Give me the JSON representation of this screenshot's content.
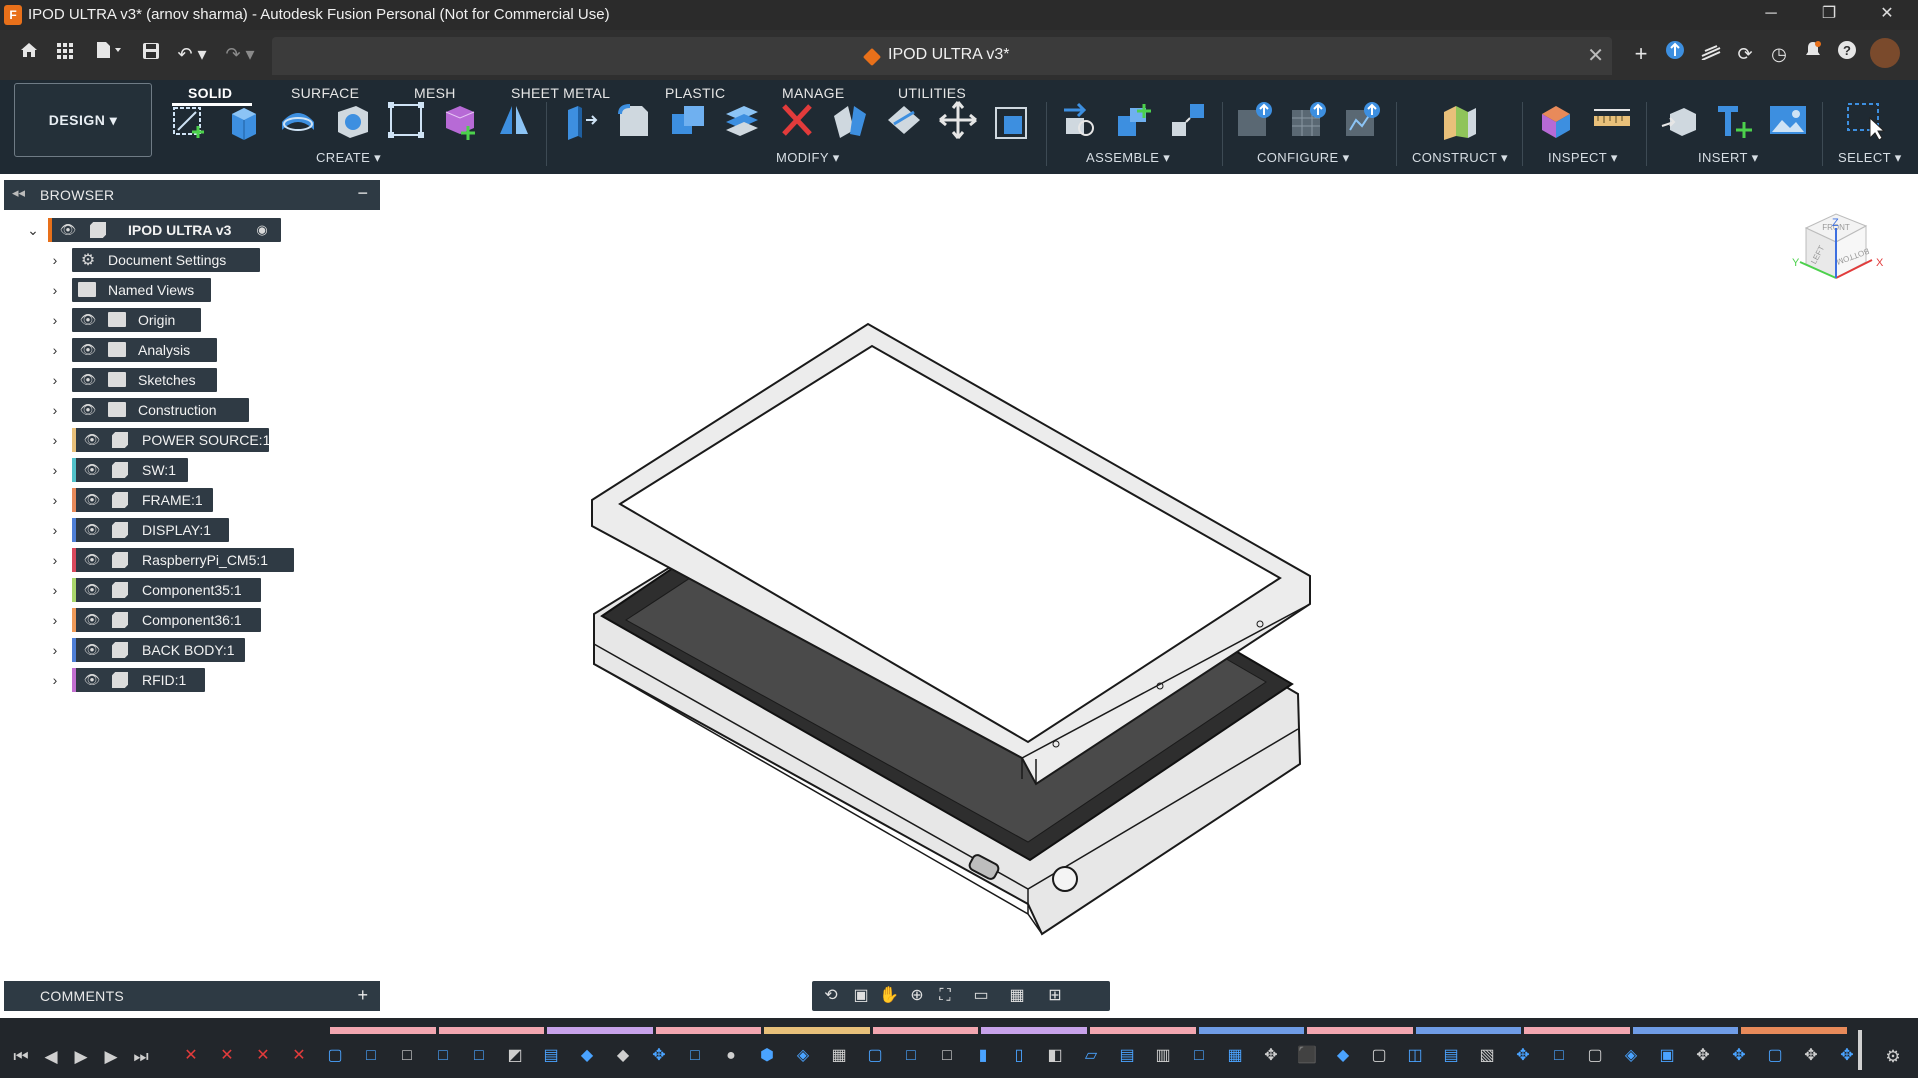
{
  "window": {
    "title": "IPOD ULTRA v3* (arnov sharma) - Autodesk Fusion Personal (Not for Commercial Use)",
    "app_icon_letter": "F",
    "controls": [
      "─",
      "❐",
      "✕"
    ]
  },
  "document_tab": {
    "title": "IPOD ULTRA v3*",
    "close": "✕"
  },
  "workspace": {
    "label": "DESIGN ▾"
  },
  "toolbar": {
    "tabs": [
      "SOLID",
      "SURFACE",
      "MESH",
      "SHEET METAL",
      "PLASTIC",
      "MANAGE",
      "UTILITIES"
    ],
    "groups": [
      "CREATE ▾",
      "MODIFY ▾",
      "ASSEMBLE ▾",
      "CONFIGURE ▾",
      "CONSTRUCT ▾",
      "INSPECT ▾",
      "INSERT ▾",
      "SELECT ▾"
    ]
  },
  "browser": {
    "title": "BROWSER",
    "collapse": "−",
    "root": "IPOD ULTRA v3",
    "items": [
      {
        "label": "Document Settings",
        "icon": "gear-icon"
      },
      {
        "label": "Named Views",
        "icon": "folder-icon"
      },
      {
        "label": "Origin",
        "icon": "folder-icon"
      },
      {
        "label": "Analysis",
        "icon": "folder-icon"
      },
      {
        "label": "Sketches",
        "icon": "folder-icon"
      },
      {
        "label": "Construction",
        "icon": "folder-icon"
      },
      {
        "label": "POWER SOURCE:1",
        "icon": "component-icon",
        "color": "#e8c07a"
      },
      {
        "label": "SW:1",
        "icon": "component-icon",
        "color": "#52c1c9"
      },
      {
        "label": "FRAME:1",
        "icon": "component-icon",
        "color": "#e88a5a"
      },
      {
        "label": "DISPLAY:1",
        "icon": "component-icon",
        "color": "#4f7fd6"
      },
      {
        "label": "RaspberryPi_CM5:1",
        "icon": "component-icon",
        "color": "#d9495c"
      },
      {
        "label": "Component35:1",
        "icon": "component-icon",
        "color": "#a9d66b"
      },
      {
        "label": "Component36:1",
        "icon": "component-icon",
        "color": "#ef9a58"
      },
      {
        "label": "BACK BODY:1",
        "icon": "component-icon",
        "color": "#4f7fd6"
      },
      {
        "label": "RFID:1",
        "icon": "component-icon",
        "color": "#c36fd0"
      }
    ]
  },
  "viewcube": {
    "faces": [
      "FRONT",
      "LEFT",
      "BOTTOM"
    ],
    "axes": [
      "X",
      "Y",
      "Z"
    ]
  },
  "comments": {
    "title": "COMMENTS",
    "add": "+"
  },
  "colors": {
    "accent": "#e8701a",
    "toolbar_bg": "#1f2a33",
    "panel_bg": "#2e3a44"
  }
}
